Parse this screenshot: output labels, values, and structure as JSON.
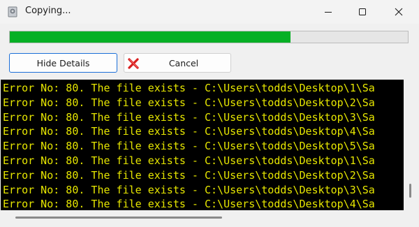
{
  "window": {
    "title": "Copying...",
    "icon": "app-copy-icon",
    "controls": {
      "minimize": "minimize-icon",
      "maximize": "maximize-icon",
      "close": "close-icon"
    }
  },
  "progress": {
    "fraction": 0.705,
    "color": "#06b025"
  },
  "buttons": {
    "hide_details": "Hide Details",
    "cancel": "Cancel",
    "cancel_icon": "red-x-icon"
  },
  "console": {
    "text_color": "#e6e600",
    "background": "#000000",
    "lines": [
      "Error No: 80. The file exists - C:\\Users\\todds\\Desktop\\1\\Sa",
      "Error No: 80. The file exists - C:\\Users\\todds\\Desktop\\2\\Sa",
      "Error No: 80. The file exists - C:\\Users\\todds\\Desktop\\3\\Sa",
      "Error No: 80. The file exists - C:\\Users\\todds\\Desktop\\4\\Sa",
      "Error No: 80. The file exists - C:\\Users\\todds\\Desktop\\5\\Sa",
      "Error No: 80. The file exists - C:\\Users\\todds\\Desktop\\1\\Sa",
      "Error No: 80. The file exists - C:\\Users\\todds\\Desktop\\2\\Sa",
      "Error No: 80. The file exists - C:\\Users\\todds\\Desktop\\3\\Sa",
      "Error No: 80. The file exists - C:\\Users\\todds\\Desktop\\4\\Sa"
    ]
  }
}
